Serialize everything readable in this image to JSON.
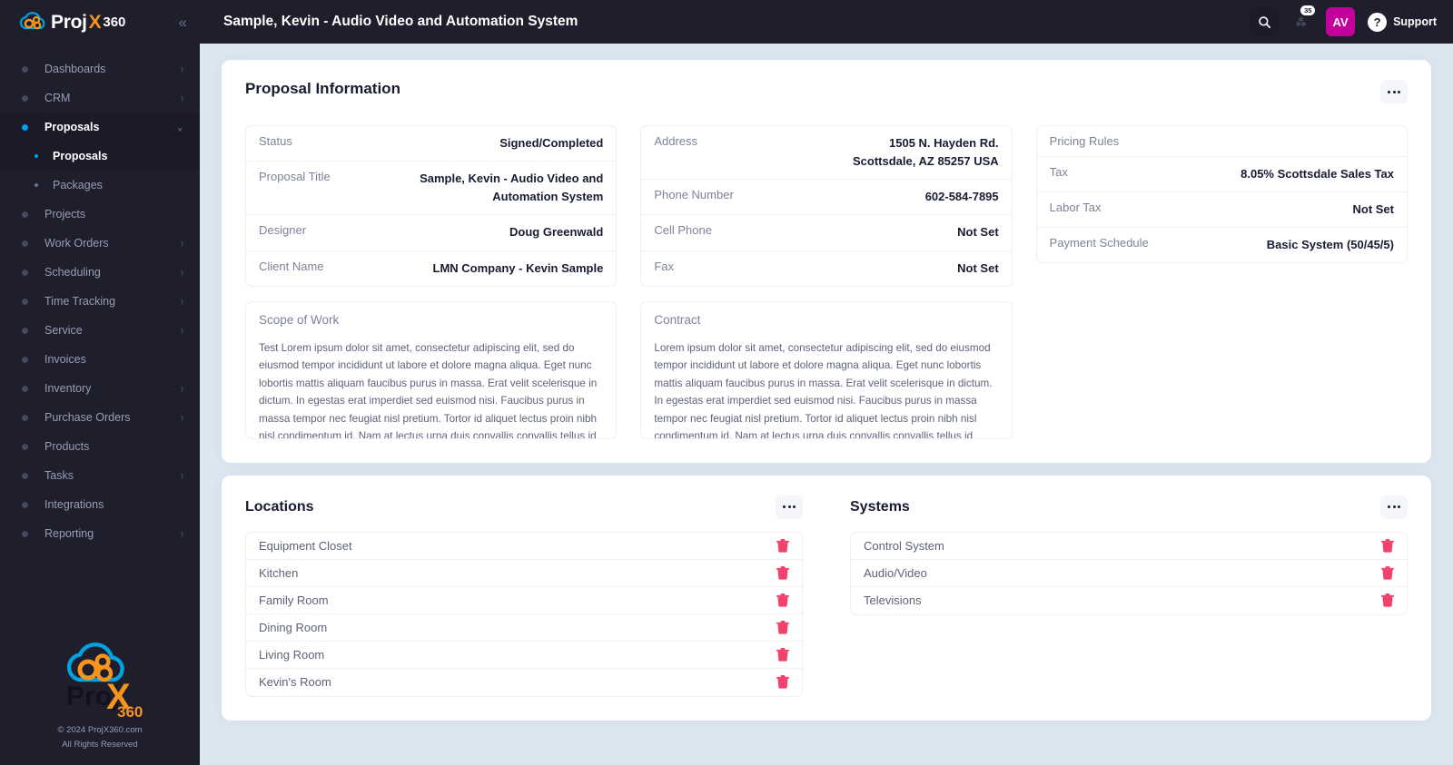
{
  "brand": {
    "name_proj": "Proj",
    "name_x": "X",
    "name_360": "360",
    "accent": "#f7941e",
    "cloud_color": "#00a3e0"
  },
  "sidebar": {
    "collapse_icon": "chevrons-left-icon",
    "items": [
      {
        "label": "Dashboards",
        "chevron": "›",
        "active": false
      },
      {
        "label": "CRM",
        "chevron": "›",
        "active": false
      },
      {
        "label": "Proposals",
        "chevron": "⌄",
        "active": true
      }
    ],
    "sub_items": [
      {
        "label": "Proposals",
        "active": true
      },
      {
        "label": "Packages",
        "active": false
      }
    ],
    "items2": [
      {
        "label": "Projects",
        "chevron": "",
        "active": false
      },
      {
        "label": "Work Orders",
        "chevron": "›",
        "active": false
      },
      {
        "label": "Scheduling",
        "chevron": "›",
        "active": false
      },
      {
        "label": "Time Tracking",
        "chevron": "›",
        "active": false
      },
      {
        "label": "Service",
        "chevron": "›",
        "active": false
      },
      {
        "label": "Invoices",
        "chevron": "",
        "active": false
      },
      {
        "label": "Inventory",
        "chevron": "›",
        "active": false
      },
      {
        "label": "Purchase Orders",
        "chevron": "›",
        "active": false
      },
      {
        "label": "Products",
        "chevron": "",
        "active": false
      },
      {
        "label": "Tasks",
        "chevron": "›",
        "active": false
      },
      {
        "label": "Integrations",
        "chevron": "",
        "active": false
      },
      {
        "label": "Reporting",
        "chevron": "›",
        "active": false
      }
    ],
    "footer": {
      "copyright": "© 2024 ProjX360.com",
      "rights": "All Rights Reserved"
    }
  },
  "topbar": {
    "title": "Sample, Kevin - Audio Video and Automation System",
    "search_icon": "search-icon",
    "notifications_icon": "notifications-icon",
    "notifications_count": "35",
    "avatar_initials": "AV",
    "avatar_color": "#c4009c",
    "support_label": "Support",
    "support_icon": "question-mark-icon"
  },
  "proposal_card": {
    "title": "Proposal Information",
    "menu_icon": "ellipsis-icon",
    "col1": [
      {
        "label": "Status",
        "value": "Signed/Completed"
      },
      {
        "label": "Proposal Title",
        "value": "Sample, Kevin - Audio Video and Automation System"
      },
      {
        "label": "Designer",
        "value": "Doug Greenwald"
      },
      {
        "label": "Client Name",
        "value": "LMN Company - Kevin Sample"
      }
    ],
    "col2": [
      {
        "label": "Address",
        "value": "1505 N. Hayden Rd. Scottsdale, AZ 85257 USA"
      },
      {
        "label": "Phone Number",
        "value": "602-584-7895"
      },
      {
        "label": "Cell Phone",
        "value": "Not Set"
      },
      {
        "label": "Fax",
        "value": "Not Set"
      }
    ],
    "col3": [
      {
        "label": "Pricing Rules",
        "value": ""
      },
      {
        "label": "Tax",
        "value": "8.05% Scottsdale Sales Tax"
      },
      {
        "label": "Labor Tax",
        "value": "Not Set"
      },
      {
        "label": "Payment Schedule",
        "value": "Basic System (50/45/5)"
      }
    ],
    "scope_of_work": {
      "title": "Scope of Work",
      "body": "Test Lorem ipsum dolor sit amet, consectetur adipiscing elit, sed do eiusmod tempor incididunt ut labore et dolore magna aliqua. Eget nunc lobortis mattis aliquam faucibus purus in massa. Erat velit scelerisque in dictum. In egestas erat imperdiet sed euismod nisi. Faucibus purus in massa tempor nec feugiat nisl pretium. Tortor id aliquet lectus proin nibh nisl condimentum id. Nam at lectus urna duis convallis convallis tellus id interdum. Sit amet commodo nulla facilisi. Laoreet non curabit"
    },
    "contract": {
      "title": "Contract",
      "body": "Lorem ipsum dolor sit amet, consectetur adipiscing elit, sed do eiusmod tempor incididunt ut labore et dolore magna aliqua. Eget nunc lobortis mattis aliquam faucibus purus in massa. Erat velit scelerisque in dictum. In egestas erat imperdiet sed euismod nisi. Faucibus purus in massa tempor nec feugiat nisl pretium. Tortor id aliquet lectus proin nibh nisl condimentum id. Nam at lectus urna duis convallis convallis tellus id interdum. Sit amet commodo nulla facilisi. Laoreet non curabitur gravid"
    }
  },
  "locations": {
    "title": "Locations",
    "menu_icon": "ellipsis-icon",
    "delete_icon": "trash-icon",
    "items": [
      "Equipment Closet",
      "Kitchen",
      "Family Room",
      "Dining Room",
      "Living Room",
      "Kevin's Room"
    ]
  },
  "systems": {
    "title": "Systems",
    "menu_icon": "ellipsis-icon",
    "delete_icon": "trash-icon",
    "items": [
      "Control System",
      "Audio/Video",
      "Televisions"
    ]
  },
  "colors": {
    "sidebar_bg": "#1e1e2d",
    "page_bg": "#dce6f0",
    "accent_blue": "#009ef7",
    "trash_red": "#f1416c",
    "avatar_magenta": "#c4009c"
  }
}
